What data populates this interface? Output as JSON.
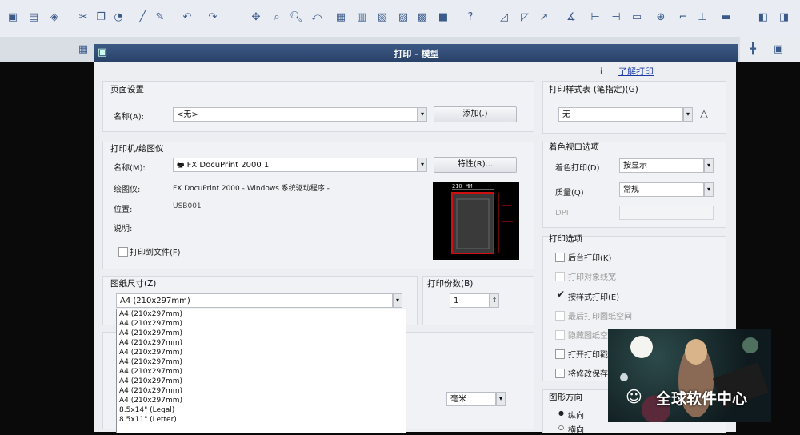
{
  "window_title": "打印 - 模型",
  "help_link": "了解打印",
  "info_icon": "i",
  "page_setup": {
    "header": "页面设置",
    "name_label": "名称(A):",
    "name_value": "<无>",
    "add_button": "添加(.)"
  },
  "printer": {
    "header": "打印机/绘图仪",
    "name_label": "名称(M):",
    "name_value": "FX DocuPrint 2000 1",
    "properties_button": "特性(R)...",
    "plotter_label": "绘图仪:",
    "plotter_value": "FX DocuPrint 2000 - Windows 系统驱动程序 -",
    "where_label": "位置:",
    "where_value": "USB001",
    "desc_label": "说明:",
    "print_to_file_label": "打印到文件(F)",
    "preview_dim": "210 MM"
  },
  "paper_size": {
    "header": "图纸尺寸(Z)",
    "value": "A4 (210x297mm)",
    "options": [
      "A4 (210x297mm)",
      "A4 (210x297mm)",
      "A4 (210x297mm)",
      "A4 (210x297mm)",
      "A4 (210x297mm)",
      "A4 (210x297mm)",
      "A4 (210x297mm)",
      "A4 (210x297mm)",
      "A4 (210x297mm)",
      "A4 (210x297mm)",
      "8.5x14\" (Legal)",
      "8.5x11\" (Letter)"
    ]
  },
  "copies": {
    "header": "打印份数(B)",
    "value": "1"
  },
  "plot_style": {
    "header": "打印样式表 (笔指定)(G)",
    "value": "无"
  },
  "shaded": {
    "header": "着色视口选项",
    "shade_label": "着色打印(D)",
    "shade_value": "按显示",
    "quality_label": "质量(Q)",
    "quality_value": "常规",
    "dpi_label": "DPI"
  },
  "plot_options": {
    "header": "打印选项",
    "items": [
      {
        "label": "后台打印(K)",
        "checked": false
      },
      {
        "label": "打印对象线宽",
        "checked": false
      },
      {
        "label": "按样式打印(E)",
        "checked": true
      },
      {
        "label": "最后打印图纸空间",
        "checked": false
      },
      {
        "label": "隐藏图纸空间对象",
        "checked": false
      },
      {
        "label": "打开打印戳记",
        "checked": false
      },
      {
        "label": "将修改保存到布局",
        "checked": false
      }
    ]
  },
  "orientation": {
    "header": "图形方向",
    "portrait": "纵向",
    "landscape": "横向"
  },
  "scale_value": "毫米",
  "watermark_text": "全球软件中心",
  "colors": {
    "titlebar": "#2a4269",
    "dialog_bg": "#eceef2",
    "link": "#1b3aa8",
    "preview_border": "#d01010"
  }
}
